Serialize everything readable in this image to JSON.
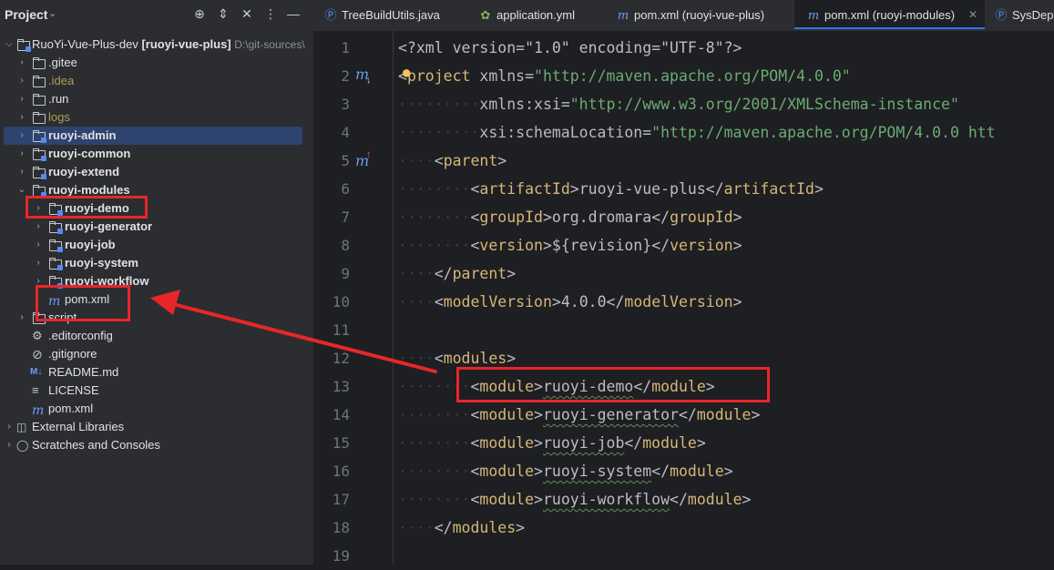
{
  "panel": {
    "title": "Project",
    "root_name": "RuoYi-Vue-Plus-dev",
    "root_module": "[ruoyi-vue-plus]",
    "root_path": "D:\\git-sources\\"
  },
  "tree": [
    {
      "label": ".gitee"
    },
    {
      "label": ".idea"
    },
    {
      "label": ".run"
    },
    {
      "label": "logs"
    },
    {
      "label": "ruoyi-admin"
    },
    {
      "label": "ruoyi-common"
    },
    {
      "label": "ruoyi-extend"
    },
    {
      "label": "ruoyi-modules"
    },
    {
      "label": "ruoyi-demo"
    },
    {
      "label": "ruoyi-generator"
    },
    {
      "label": "ruoyi-job"
    },
    {
      "label": "ruoyi-system"
    },
    {
      "label": "ruoyi-workflow"
    },
    {
      "label": "pom.xml"
    },
    {
      "label": "script"
    },
    {
      "label": ".editorconfig"
    },
    {
      "label": ".gitignore"
    },
    {
      "label": "README.md"
    },
    {
      "label": "LICENSE"
    },
    {
      "label": "pom.xml"
    },
    {
      "label": "External Libraries"
    },
    {
      "label": "Scratches and Consoles"
    }
  ],
  "tabs": [
    {
      "label": "TreeBuildUtils.java",
      "icon": "java-class-icon"
    },
    {
      "label": "application.yml",
      "icon": "yaml-icon"
    },
    {
      "label": "pom.xml (ruoyi-vue-plus)",
      "icon": "maven-icon"
    },
    {
      "label": "pom.xml (ruoyi-modules)",
      "icon": "maven-icon"
    },
    {
      "label": "SysDep",
      "icon": "java-class-icon"
    }
  ],
  "editor": {
    "line_numbers": [
      "1",
      "2",
      "3",
      "4",
      "5",
      "6",
      "7",
      "8",
      "9",
      "10",
      "11",
      "12",
      "13",
      "14",
      "15",
      "16",
      "17",
      "18",
      "19"
    ],
    "code": {
      "xml_decl": "<?xml version=\"1.0\" encoding=\"UTF-8\"?>",
      "project_tag": "project",
      "xmlns_attr": "xmlns",
      "xmlns_val": "\"http://maven.apache.org/POM/4.0.0\"",
      "xsi_attr": "xmlns:xsi",
      "xsi_val": "\"http://www.w3.org/2001/XMLSchema-instance\"",
      "schema_attr": "xsi:schemaLocation",
      "schema_val": "\"http://maven.apache.org/POM/4.0.0 htt",
      "parent": "parent",
      "artifactId": "artifactId",
      "artifact_val": "ruoyi-vue-plus",
      "groupId": "groupId",
      "group_val": "org.dromara",
      "version": "version",
      "version_val": "${revision}",
      "modelVersion": "modelVersion",
      "model_val": "4.0.0",
      "modules": "modules",
      "module": "module",
      "mod_demo": "ruoyi-demo",
      "mod_generator": "ruoyi-generator",
      "mod_job": "ruoyi-job",
      "mod_system": "ruoyi-system",
      "mod_workflow": "ruoyi-workflow"
    }
  },
  "colors": {
    "annotation": "#e8262a",
    "selection": "#2e436e",
    "tag": "#d5b778",
    "string": "#6aab73"
  }
}
